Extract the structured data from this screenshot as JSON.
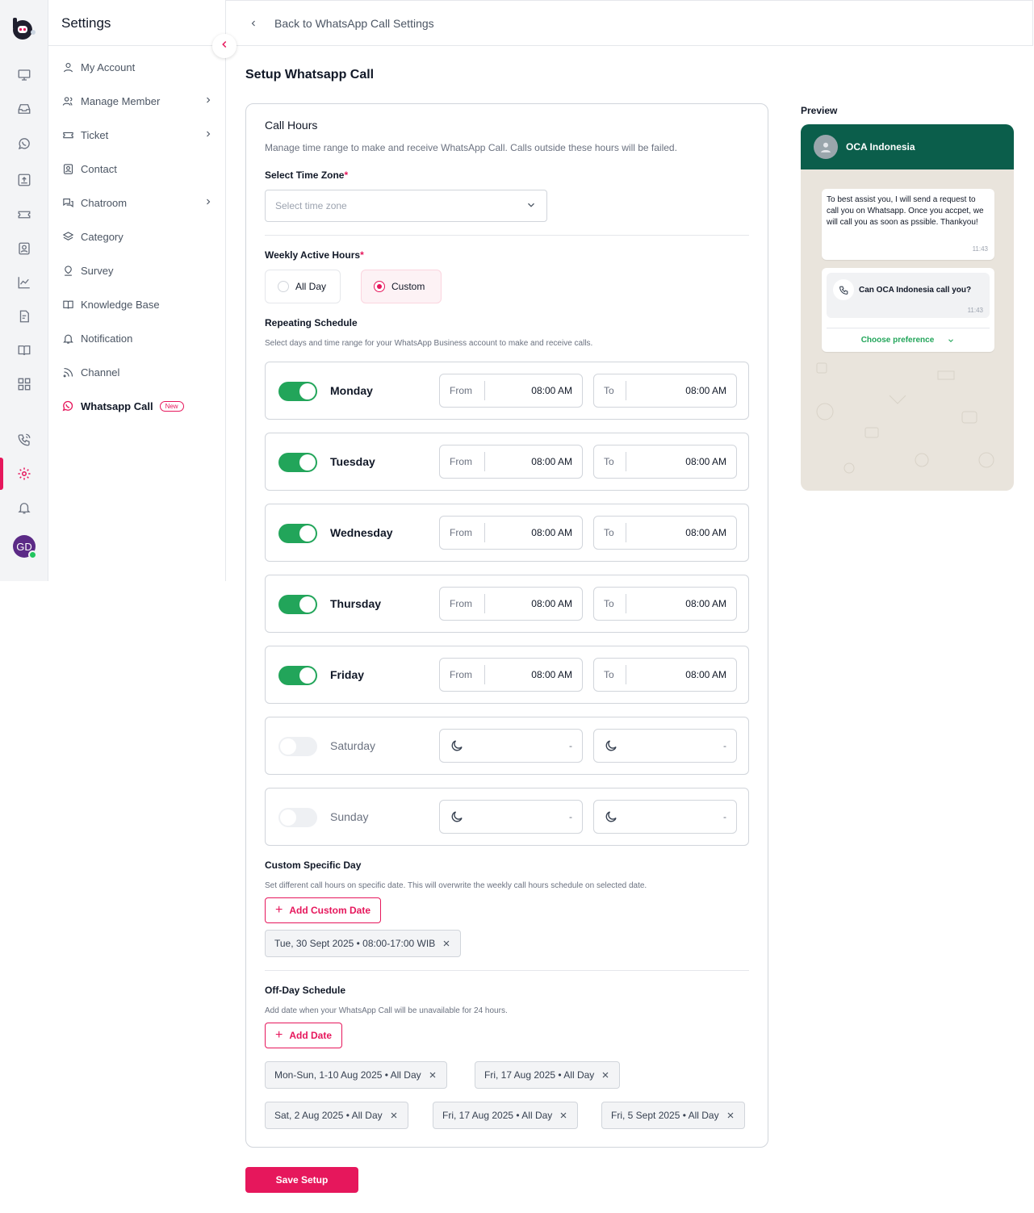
{
  "sidebar": {
    "title": "Settings",
    "items": [
      {
        "label": "My Account",
        "icon": "user-icon"
      },
      {
        "label": "Manage Member",
        "icon": "users-icon",
        "has_children": true
      },
      {
        "label": "Ticket",
        "icon": "ticket-icon",
        "has_children": true
      },
      {
        "label": "Contact",
        "icon": "contact-icon"
      },
      {
        "label": "Chatroom",
        "icon": "chatroom-icon",
        "has_children": true
      },
      {
        "label": "Category",
        "icon": "layers-icon"
      },
      {
        "label": "Survey",
        "icon": "survey-icon"
      },
      {
        "label": "Knowledge Base",
        "icon": "book-icon"
      },
      {
        "label": "Notification",
        "icon": "bell-icon"
      },
      {
        "label": "Channel",
        "icon": "rss-icon"
      },
      {
        "label": "Whatsapp Call",
        "icon": "whatsapp-icon",
        "badge": "New",
        "active": true
      }
    ]
  },
  "rail": {
    "avatar_initials": "GD",
    "accent": "#e6175c"
  },
  "topbar": {
    "back_label": "Back to WhatsApp Call Settings"
  },
  "page": {
    "title": "Setup Whatsapp Call"
  },
  "call_hours": {
    "title": "Call Hours",
    "description": "Manage time range to make and receive WhatsApp Call. Calls outside these hours will be failed.",
    "timezone_label": "Select Time Zone",
    "timezone_placeholder": "Select time zone",
    "weekly_label": "Weekly Active Hours",
    "options": {
      "all_day": "All Day",
      "custom": "Custom",
      "selected": "Custom"
    },
    "repeating_title": "Repeating Schedule",
    "repeating_desc": "Select days and time range for your WhatsApp Business account to make and receive calls.",
    "days": [
      {
        "name": "Monday",
        "enabled": true,
        "from_label": "From",
        "from": "08:00 AM",
        "to_label": "To",
        "to": "08:00 AM"
      },
      {
        "name": "Tuesday",
        "enabled": true,
        "from_label": "From",
        "from": "08:00 AM",
        "to_label": "To",
        "to": "08:00 AM"
      },
      {
        "name": "Wednesday",
        "enabled": true,
        "from_label": "From",
        "from": "08:00 AM",
        "to_label": "To",
        "to": "08:00 AM"
      },
      {
        "name": "Thursday",
        "enabled": true,
        "from_label": "From",
        "from": "08:00 AM",
        "to_label": "To",
        "to": "08:00 AM"
      },
      {
        "name": "Friday",
        "enabled": true,
        "from_label": "From",
        "from": "08:00 AM",
        "to_label": "To",
        "to": "08:00 AM"
      },
      {
        "name": "Saturday",
        "enabled": false,
        "from": "-",
        "to": "-"
      },
      {
        "name": "Sunday",
        "enabled": false,
        "from": "-",
        "to": "-"
      }
    ],
    "custom_title": "Custom Specific Day",
    "custom_desc": "Set different call hours on specific date. This will overwrite the weekly call hours schedule on selected date.",
    "add_custom_label": "Add Custom Date",
    "custom_chips": [
      "Tue, 30 Sept 2025 • 08:00-17:00 WIB"
    ],
    "offday_title": "Off-Day Schedule",
    "offday_desc": "Add date when your WhatsApp Call will be unavailable for 24 hours.",
    "add_date_label": "Add Date",
    "offday_chips": [
      "Mon-Sun, 1-10 Aug 2025 • All Day",
      "Fri, 17 Aug 2025 • All Day",
      "Sat, 2 Aug 2025 • All Day",
      "Fri, 17 Aug 2025 • All Day",
      "Fri, 5 Sept 2025 • All Day"
    ]
  },
  "save_label": "Save Setup",
  "preview": {
    "label": "Preview",
    "contact_name": "OCA Indonesia",
    "message": "To best assist you, I will send a request to call you on Whatsapp. Once you accpet, we will call you as soon as pssible. Thankyou!",
    "message_time": "11:43",
    "call_request": "Can OCA Indonesia call you?",
    "call_time": "11:43",
    "choose_pref": "Choose preference",
    "header_color": "#0b5e4b"
  }
}
